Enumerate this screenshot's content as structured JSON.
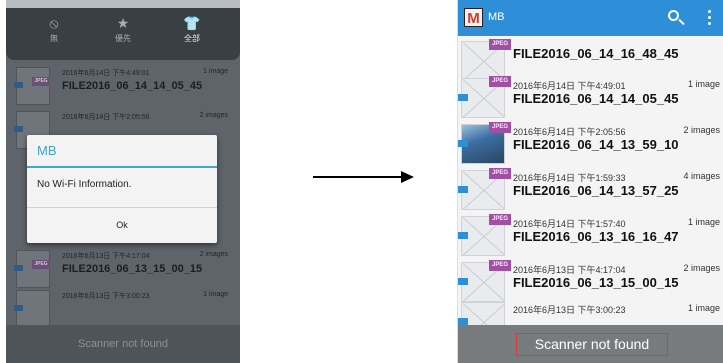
{
  "left_screen": {
    "filters": [
      {
        "icon": "no-sign-icon",
        "glyph": "⦸",
        "label": "無"
      },
      {
        "icon": "star-icon",
        "glyph": "★",
        "label": "優先"
      },
      {
        "icon": "tshirt-icon",
        "glyph": "👕",
        "label": "全部"
      }
    ],
    "rows": [
      {
        "meta": "2016年6月14日 下午4:49:01",
        "count": "1 image",
        "name": "FILE2016_06_14_14_05_45"
      },
      {
        "meta": "2016年6月14日 下午2:05:56",
        "count": "2 images",
        "name": ""
      },
      {
        "meta": "2016年6月13日 下午4:17:04",
        "count": "2 images",
        "name": "FILE2016_06_13_15_00_15"
      },
      {
        "meta": "2016年6月13日 下午3:00:23",
        "count": "1 image",
        "name": ""
      }
    ],
    "dialog": {
      "title": "MB",
      "message": "No Wi-Fi Information.",
      "ok_label": "Ok"
    },
    "status": "Scanner not found"
  },
  "right_screen": {
    "app_title": "MB",
    "logo_letter": "M",
    "badge": "JPEG",
    "first_item": "FILE2016_06_14_16_48_45",
    "rows": [
      {
        "meta": "2016年6月14日 下午4:49:01",
        "count": "1 image",
        "name": "FILE2016_06_14_14_05_45"
      },
      {
        "meta": "2016年6月14日 下午2:05:56",
        "count": "2 images",
        "name": "FILE2016_06_14_13_59_10"
      },
      {
        "meta": "2016年6月14日 下午1:59:33",
        "count": "4 images",
        "name": "FILE2016_06_14_13_57_25"
      },
      {
        "meta": "2016年6月14日 下午1:57:40",
        "count": "1 image",
        "name": "FILE2016_06_13_16_16_47"
      },
      {
        "meta": "2016年6月13日 下午4:17:04",
        "count": "2 images",
        "name": "FILE2016_06_13_15_00_15"
      },
      {
        "meta": "2016年6月13日 下午3:00:23",
        "count": "1 image",
        "name": ""
      }
    ],
    "status": "Scanner not found"
  },
  "colors": {
    "action_bar": "#2e8fd8",
    "jpeg_badge": "#a24ea5",
    "dialog_accent": "#3fa6cc",
    "status_highlight": "#d93a33"
  }
}
